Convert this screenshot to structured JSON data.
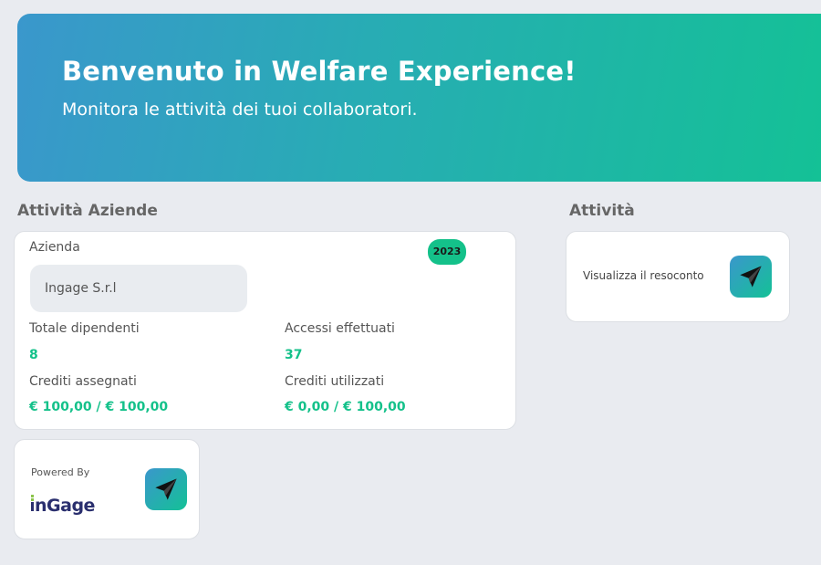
{
  "hero": {
    "title": "Benvenuto in Welfare Experience!",
    "subtitle": "Monitora le attività dei tuoi collaboratori."
  },
  "sections": {
    "companies_title": "Attività Aziende",
    "activity_title": "Attività"
  },
  "company_card": {
    "company_label": "Azienda",
    "company_value": "Ingage S.r.l",
    "year_badge": "2023",
    "employees_label": "Totale dipendenti",
    "employees_value": "8",
    "access_label": "Accessi effettuati",
    "access_value": "37",
    "assigned_label": "Crediti assegnati",
    "assigned_value": "€ 100,00 / € 100,00",
    "used_label": "Crediti utilizzati",
    "used_value": "€ 0,00 / € 100,00"
  },
  "activity_card": {
    "text": "Visualizza il resoconto",
    "icon": "paper-plane-icon"
  },
  "powered_card": {
    "text": "Powered By",
    "logo_text": "inGage",
    "icon": "paper-plane-icon"
  },
  "colors": {
    "accent_green": "#14c18a",
    "gradient_start": "#3a97cc",
    "gradient_end": "#14c196",
    "background": "#e9ebf0"
  }
}
